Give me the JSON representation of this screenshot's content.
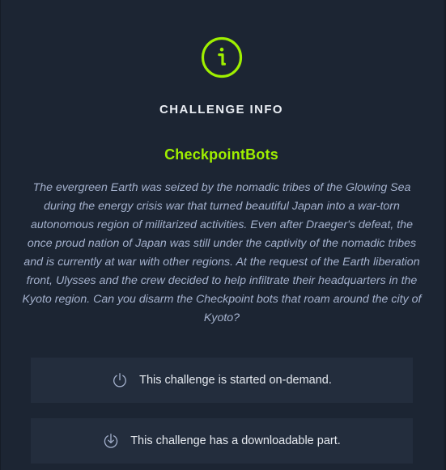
{
  "header": {
    "icon": "info-circle-icon",
    "title": "CHALLENGE INFO"
  },
  "challenge": {
    "name": "CheckpointBots",
    "description": "The evergreen Earth was seized by the nomadic tribes of the Glowing Sea during the energy crisis war that turned beautiful Japan into a war-torn autonomous region of militarized activities. Even after Draeger's defeat, the once proud nation of Japan was still under the captivity of the nomadic tribes and is currently at war with other regions. At the request of the Earth liberation front, Ulysses and the crew decided to help infiltrate their headquarters in the Kyoto region. Can you disarm the Checkpoint bots that roam around the city of Kyoto?"
  },
  "features": [
    {
      "icon": "power-icon",
      "text": "This challenge is started on-demand."
    },
    {
      "icon": "download-icon",
      "text": "This challenge has a downloadable part."
    }
  ],
  "colors": {
    "accent": "#9fef00",
    "background": "#1c2533",
    "card": "#232d3d",
    "text": "#e6eaf0",
    "muted": "#a4b1cd"
  }
}
